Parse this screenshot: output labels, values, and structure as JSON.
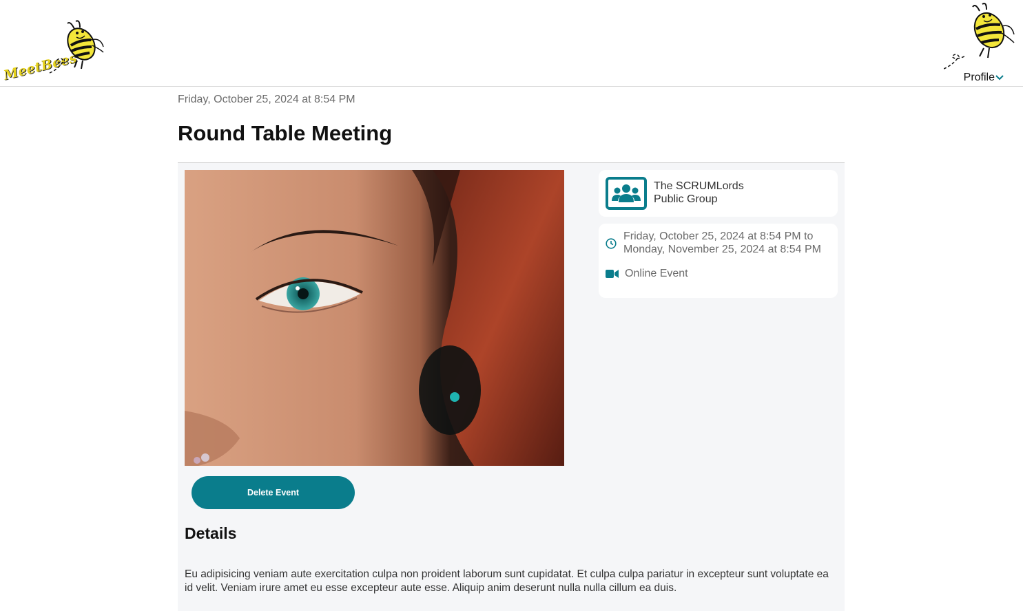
{
  "header": {
    "logo_text": "MeetBees",
    "profile_label": "Profile"
  },
  "event": {
    "date": "Friday, October 25, 2024 at 8:54 PM",
    "title": "Round Table Meeting",
    "delete_label": "Delete Event",
    "details_heading": "Details",
    "details_text": "Eu adipisicing veniam aute exercitation culpa non proident laborum sunt cupidatat. Et culpa culpa pariatur in excepteur sunt voluptate ea id velit. Veniam irure amet eu esse excepteur aute esse. Aliquip anim deserunt nulla nulla cillum ea duis."
  },
  "group": {
    "name": "The SCRUMLords",
    "type": "Public Group"
  },
  "schedule": {
    "start": "Friday, October 25, 2024 at 8:54 PM to",
    "end": "Monday, November 25, 2024 at 8:54 PM",
    "location": "Online Event"
  },
  "colors": {
    "accent": "#0a7d8c",
    "panel_bg": "#f5f6f8",
    "bee_yellow": "#f3e63a"
  },
  "icons": [
    "bee-logo-icon",
    "bee-avatar-icon",
    "chevron-down-icon",
    "group-icon",
    "clock-icon",
    "video-icon"
  ]
}
